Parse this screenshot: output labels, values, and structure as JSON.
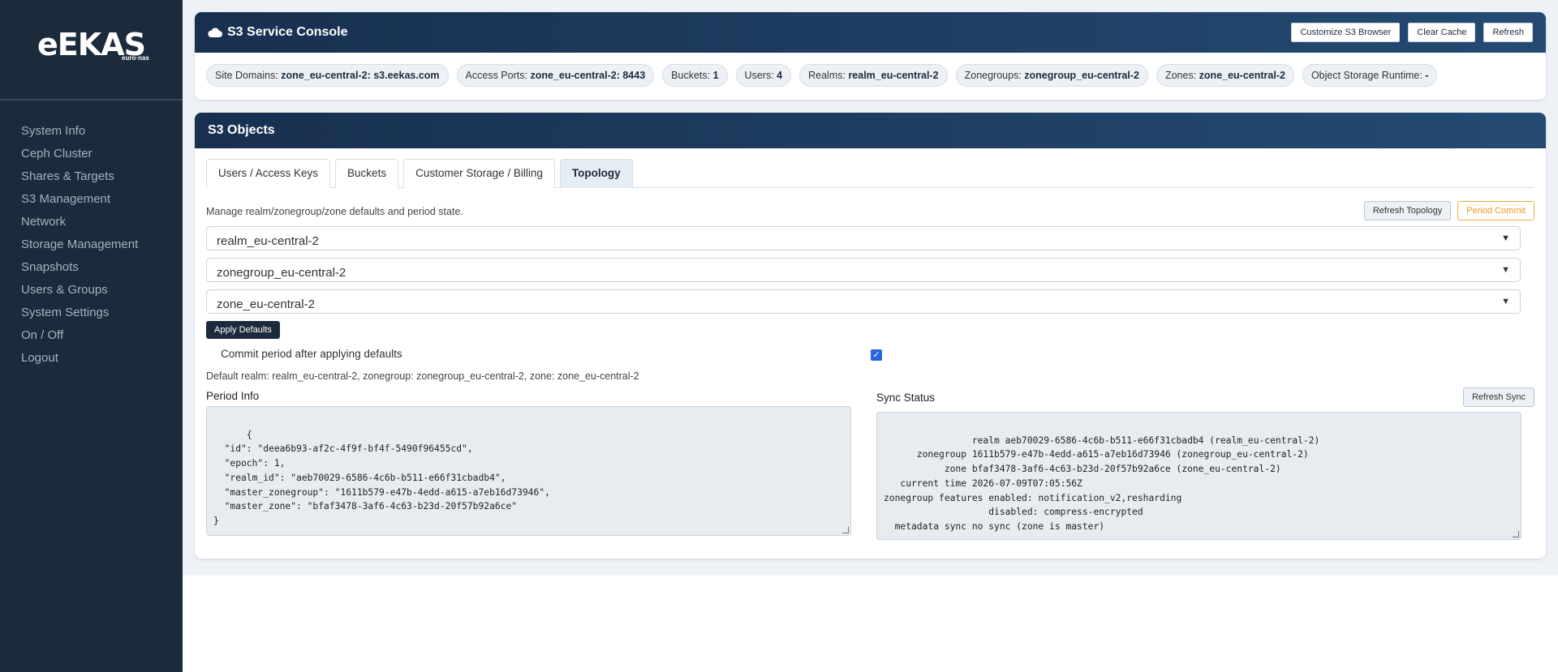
{
  "brand": {
    "name": "eEKAS",
    "sub": "euro·nas"
  },
  "sidebar": {
    "items": [
      {
        "label": "System Info"
      },
      {
        "label": "Ceph Cluster"
      },
      {
        "label": "Shares & Targets"
      },
      {
        "label": "S3 Management"
      },
      {
        "label": "Network"
      },
      {
        "label": "Storage Management"
      },
      {
        "label": "Snapshots"
      },
      {
        "label": "Users & Groups"
      },
      {
        "label": "System Settings"
      },
      {
        "label": "On / Off"
      },
      {
        "label": "Logout"
      }
    ]
  },
  "console": {
    "title": "S3 Service Console",
    "buttons": {
      "customize": "Customize S3 Browser",
      "clear_cache": "Clear Cache",
      "refresh": "Refresh"
    },
    "chips": {
      "site_domains": {
        "label": "Site Domains:",
        "value": "zone_eu-central-2: s3.eekas.com"
      },
      "access_ports": {
        "label": "Access Ports:",
        "value": "zone_eu-central-2: 8443"
      },
      "buckets": {
        "label": "Buckets:",
        "value": "1"
      },
      "users": {
        "label": "Users:",
        "value": "4"
      },
      "realms": {
        "label": "Realms:",
        "value": "realm_eu-central-2"
      },
      "zonegroups": {
        "label": "Zonegroups:",
        "value": "zonegroup_eu-central-2"
      },
      "zones": {
        "label": "Zones:",
        "value": "zone_eu-central-2"
      },
      "runtime": {
        "label": "Object Storage Runtime:",
        "value": "-"
      }
    }
  },
  "objects": {
    "title": "S3 Objects",
    "tabs": [
      {
        "label": "Users / Access Keys"
      },
      {
        "label": "Buckets"
      },
      {
        "label": "Customer Storage / Billing"
      },
      {
        "label": "Topology"
      }
    ],
    "description": "Manage realm/zonegroup/zone defaults and period state.",
    "refresh_topology": "Refresh Topology",
    "period_commit": "Period Commit",
    "selects": {
      "realm": "realm_eu-central-2",
      "zonegroup": "zonegroup_eu-central-2",
      "zone": "zone_eu-central-2"
    },
    "apply_defaults": "Apply Defaults",
    "commit_label": "Commit period after applying defaults",
    "commit_checked": true,
    "default_text": "Default realm: realm_eu-central-2, zonegroup: zonegroup_eu-central-2, zone: zone_eu-central-2",
    "period_info_label": "Period Info",
    "period_info": "{\n  \"id\": \"deea6b93-af2c-4f9f-bf4f-5490f96455cd\",\n  \"epoch\": 1,\n  \"realm_id\": \"aeb70029-6586-4c6b-b511-e66f31cbadb4\",\n  \"master_zonegroup\": \"1611b579-e47b-4edd-a615-a7eb16d73946\",\n  \"master_zone\": \"bfaf3478-3af6-4c63-b23d-20f57b92a6ce\"\n}",
    "sync_status_label": "Sync Status",
    "refresh_sync": "Refresh Sync",
    "sync_status": "          realm aeb70029-6586-4c6b-b511-e66f31cbadb4 (realm_eu-central-2)\n      zonegroup 1611b579-e47b-4edd-a615-a7eb16d73946 (zonegroup_eu-central-2)\n           zone bfaf3478-3af6-4c63-b23d-20f57b92a6ce (zone_eu-central-2)\n   current time 2026-07-09T07:05:56Z\nzonegroup features enabled: notification_v2,resharding\n                   disabled: compress-encrypted\n  metadata sync no sync (zone is master)"
  }
}
